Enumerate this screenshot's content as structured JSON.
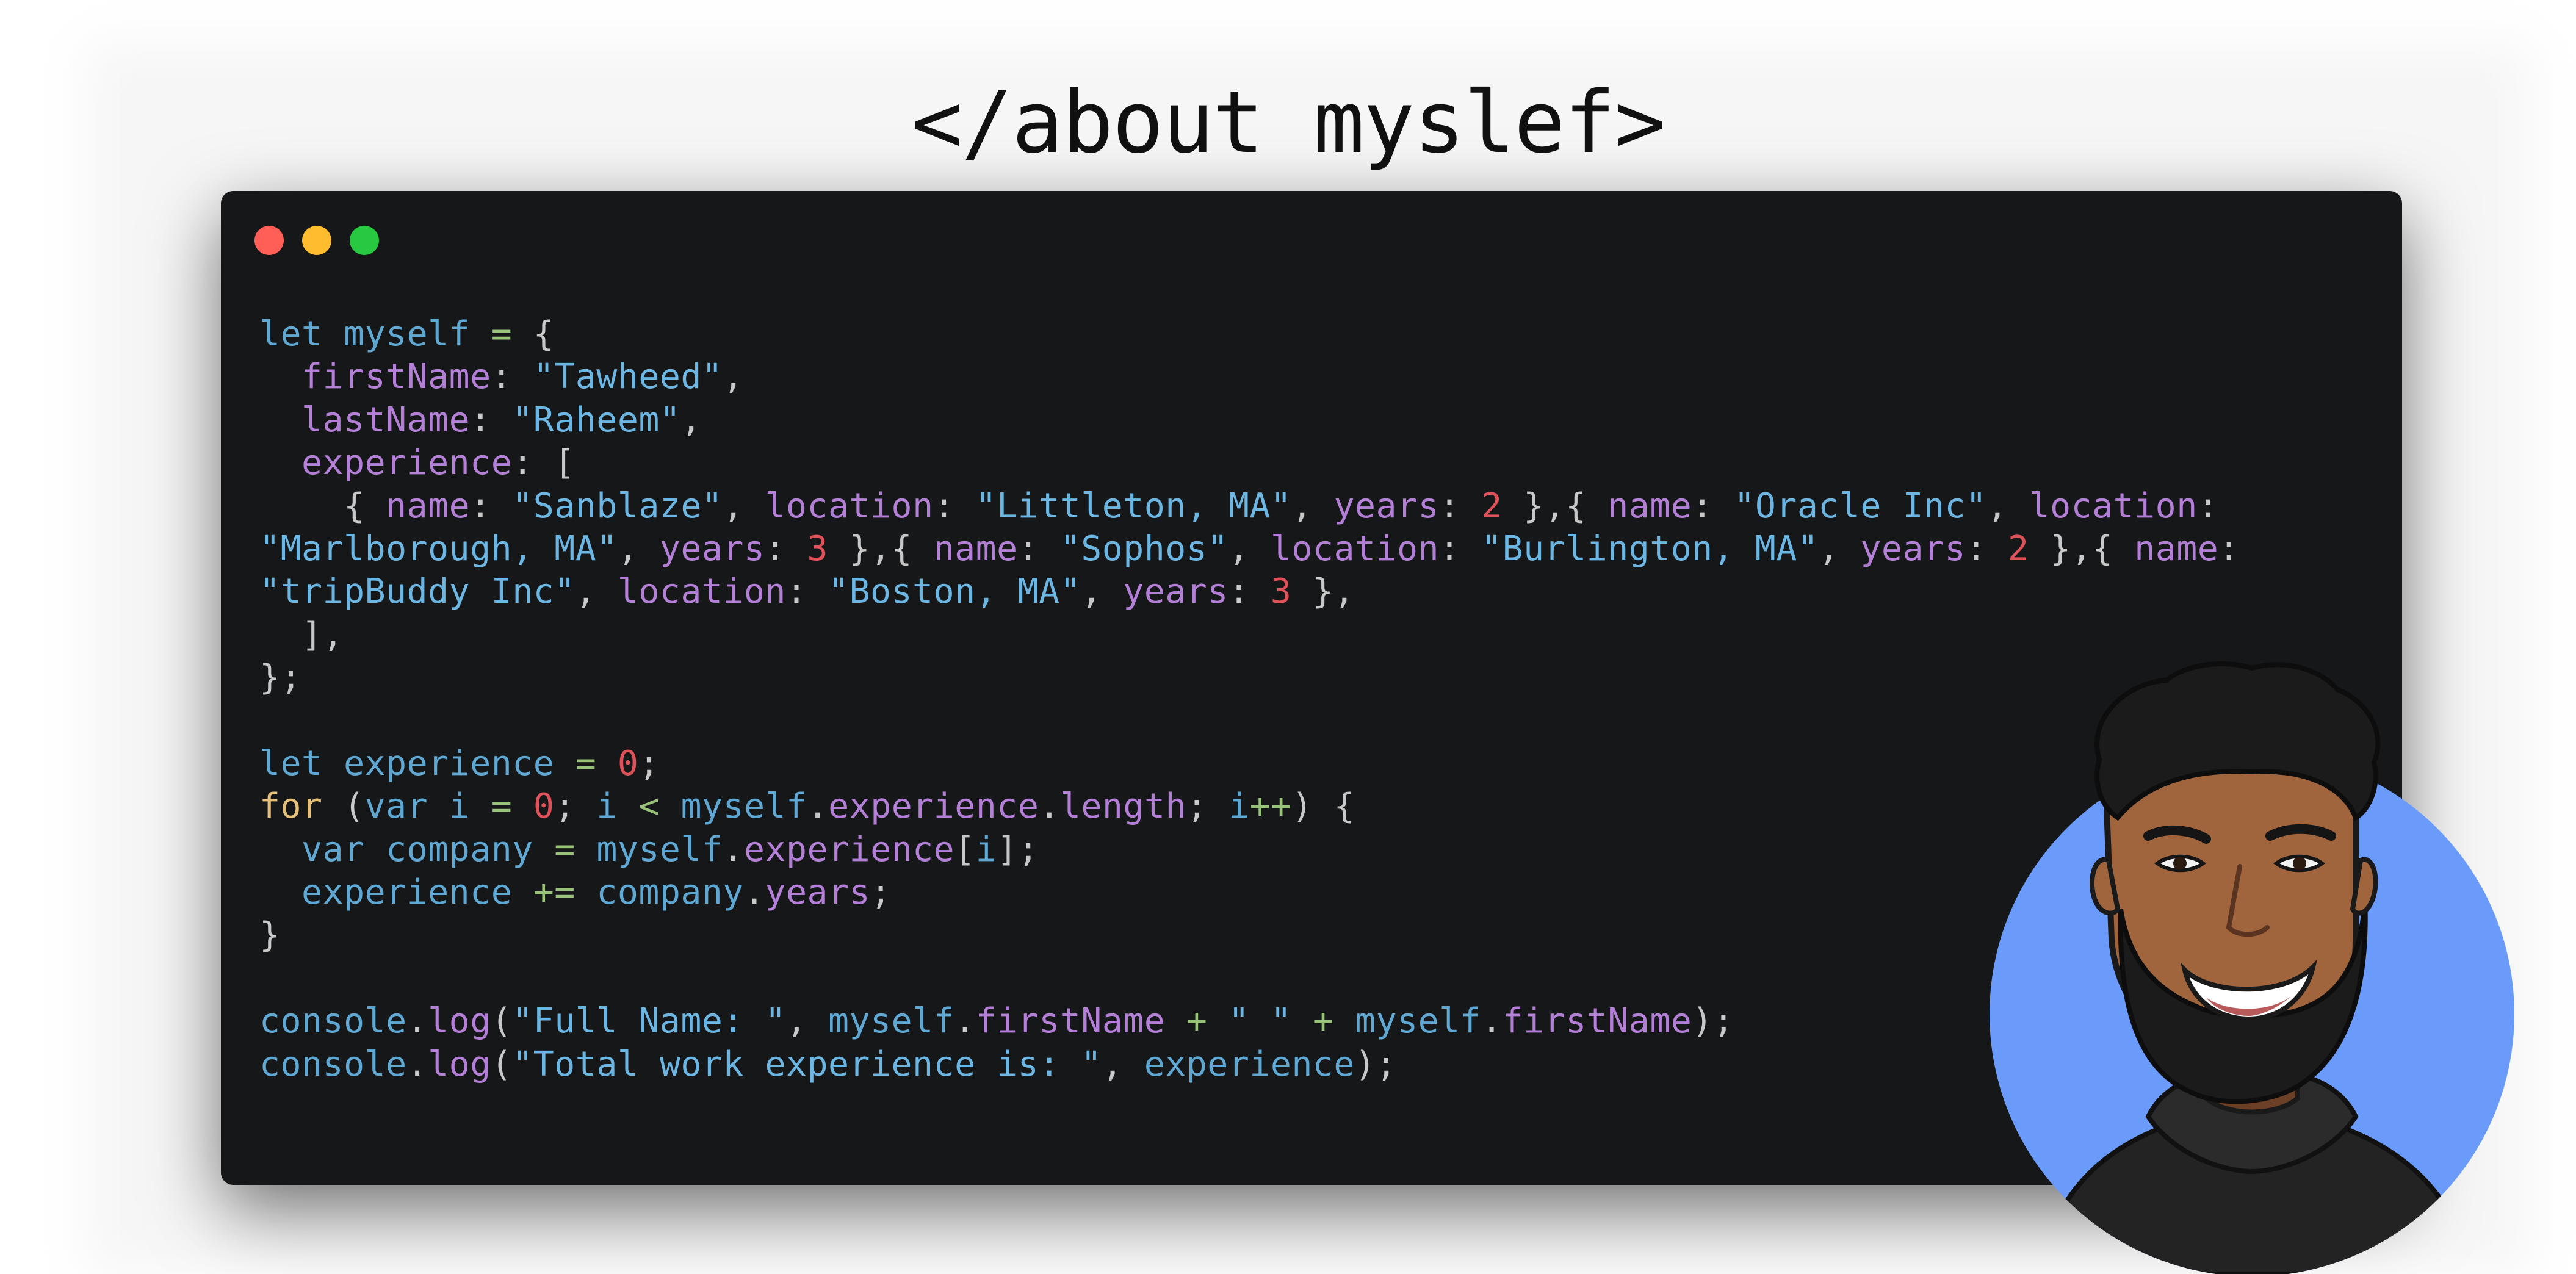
{
  "page": {
    "title": "</about myslef>"
  },
  "window_controls": [
    "close",
    "minimize",
    "maximize"
  ],
  "colors": {
    "editor_background": "#161719",
    "keyword": "#5fa8d3",
    "property": "#b47fd6",
    "string": "#6cb6e3",
    "number": "#e0525a",
    "operator": "#98c379",
    "avatar_circle": "#6a9bfa"
  },
  "code": {
    "lines": [
      [
        [
          "kw",
          "let"
        ],
        [
          "pn",
          " "
        ],
        [
          "id",
          "myself"
        ],
        [
          "pn",
          " "
        ],
        [
          "op",
          "="
        ],
        [
          "pn",
          " {"
        ]
      ],
      [
        [
          "pn",
          "  "
        ],
        [
          "prop",
          "firstName"
        ],
        [
          "pn",
          ": "
        ],
        [
          "str",
          "\"Tawheed\""
        ],
        [
          "pn",
          ","
        ]
      ],
      [
        [
          "pn",
          "  "
        ],
        [
          "prop",
          "lastName"
        ],
        [
          "pn",
          ": "
        ],
        [
          "str",
          "\"Raheem\""
        ],
        [
          "pn",
          ","
        ]
      ],
      [
        [
          "pn",
          "  "
        ],
        [
          "prop",
          "experience"
        ],
        [
          "pn",
          ": ["
        ]
      ],
      [
        [
          "pn",
          "    { "
        ],
        [
          "prop",
          "name"
        ],
        [
          "pn",
          ": "
        ],
        [
          "str",
          "\"Sanblaze\""
        ],
        [
          "pn",
          ", "
        ],
        [
          "prop",
          "location"
        ],
        [
          "pn",
          ": "
        ],
        [
          "str",
          "\"Littleton, MA\""
        ],
        [
          "pn",
          ", "
        ],
        [
          "prop",
          "years"
        ],
        [
          "pn",
          ": "
        ],
        [
          "num",
          "2"
        ],
        [
          "pn",
          " },{ "
        ],
        [
          "prop",
          "name"
        ],
        [
          "pn",
          ": "
        ],
        [
          "str",
          "\"Oracle Inc\""
        ],
        [
          "pn",
          ", "
        ],
        [
          "prop",
          "location"
        ],
        [
          "pn",
          ":"
        ]
      ],
      [
        [
          "str",
          "\"Marlborough, MA\""
        ],
        [
          "pn",
          ", "
        ],
        [
          "prop",
          "years"
        ],
        [
          "pn",
          ": "
        ],
        [
          "num",
          "3"
        ],
        [
          "pn",
          " },{ "
        ],
        [
          "prop",
          "name"
        ],
        [
          "pn",
          ": "
        ],
        [
          "str",
          "\"Sophos\""
        ],
        [
          "pn",
          ", "
        ],
        [
          "prop",
          "location"
        ],
        [
          "pn",
          ": "
        ],
        [
          "str",
          "\"Burlington, MA\""
        ],
        [
          "pn",
          ", "
        ],
        [
          "prop",
          "years"
        ],
        [
          "pn",
          ": "
        ],
        [
          "num",
          "2"
        ],
        [
          "pn",
          " },{ "
        ],
        [
          "prop",
          "name"
        ],
        [
          "pn",
          ":"
        ]
      ],
      [
        [
          "str",
          "\"tripBuddy Inc\""
        ],
        [
          "pn",
          ", "
        ],
        [
          "prop",
          "location"
        ],
        [
          "pn",
          ": "
        ],
        [
          "str",
          "\"Boston, MA\""
        ],
        [
          "pn",
          ", "
        ],
        [
          "prop",
          "years"
        ],
        [
          "pn",
          ": "
        ],
        [
          "num",
          "3"
        ],
        [
          "pn",
          " },"
        ]
      ],
      [
        [
          "pn",
          "  ],"
        ]
      ],
      [
        [
          "pn",
          "};"
        ]
      ],
      [],
      [
        [
          "kw",
          "let"
        ],
        [
          "pn",
          " "
        ],
        [
          "id",
          "experience"
        ],
        [
          "pn",
          " "
        ],
        [
          "op",
          "="
        ],
        [
          "pn",
          " "
        ],
        [
          "num",
          "0"
        ],
        [
          "pn",
          ";"
        ]
      ],
      [
        [
          "kwf",
          "for"
        ],
        [
          "pn",
          " ("
        ],
        [
          "kw",
          "var"
        ],
        [
          "pn",
          " "
        ],
        [
          "id",
          "i"
        ],
        [
          "pn",
          " "
        ],
        [
          "op",
          "="
        ],
        [
          "pn",
          " "
        ],
        [
          "num",
          "0"
        ],
        [
          "pn",
          "; "
        ],
        [
          "id",
          "i"
        ],
        [
          "pn",
          " "
        ],
        [
          "op",
          "<"
        ],
        [
          "pn",
          " "
        ],
        [
          "id",
          "myself"
        ],
        [
          "pn",
          "."
        ],
        [
          "prop",
          "experience"
        ],
        [
          "pn",
          "."
        ],
        [
          "prop",
          "length"
        ],
        [
          "pn",
          "; "
        ],
        [
          "id",
          "i"
        ],
        [
          "op",
          "++"
        ],
        [
          "pn",
          ") {"
        ]
      ],
      [
        [
          "pn",
          "  "
        ],
        [
          "kw",
          "var"
        ],
        [
          "pn",
          " "
        ],
        [
          "id",
          "company"
        ],
        [
          "pn",
          " "
        ],
        [
          "op",
          "="
        ],
        [
          "pn",
          " "
        ],
        [
          "id",
          "myself"
        ],
        [
          "pn",
          "."
        ],
        [
          "prop",
          "experience"
        ],
        [
          "pn",
          "["
        ],
        [
          "id",
          "i"
        ],
        [
          "pn",
          "];"
        ]
      ],
      [
        [
          "pn",
          "  "
        ],
        [
          "id",
          "experience"
        ],
        [
          "pn",
          " "
        ],
        [
          "op",
          "+="
        ],
        [
          "pn",
          " "
        ],
        [
          "id",
          "company"
        ],
        [
          "pn",
          "."
        ],
        [
          "prop",
          "years"
        ],
        [
          "pn",
          ";"
        ]
      ],
      [
        [
          "pn",
          "}"
        ]
      ],
      [],
      [
        [
          "id",
          "console"
        ],
        [
          "pn",
          "."
        ],
        [
          "prop",
          "log"
        ],
        [
          "pn",
          "("
        ],
        [
          "str",
          "\"Full Name: \""
        ],
        [
          "pn",
          ", "
        ],
        [
          "id",
          "myself"
        ],
        [
          "pn",
          "."
        ],
        [
          "prop",
          "firstName"
        ],
        [
          "pn",
          " "
        ],
        [
          "op",
          "+"
        ],
        [
          "pn",
          " "
        ],
        [
          "str",
          "\" \""
        ],
        [
          "pn",
          " "
        ],
        [
          "op",
          "+"
        ],
        [
          "pn",
          " "
        ],
        [
          "id",
          "myself"
        ],
        [
          "pn",
          "."
        ],
        [
          "prop",
          "firstName"
        ],
        [
          "pn",
          ");"
        ]
      ],
      [
        [
          "id",
          "console"
        ],
        [
          "pn",
          "."
        ],
        [
          "prop",
          "log"
        ],
        [
          "pn",
          "("
        ],
        [
          "str",
          "\"Total work experience is: \""
        ],
        [
          "pn",
          ", "
        ],
        [
          "id",
          "experience"
        ],
        [
          "pn",
          ");"
        ]
      ]
    ]
  },
  "avatar": {
    "icon": "avatar-illustration"
  }
}
